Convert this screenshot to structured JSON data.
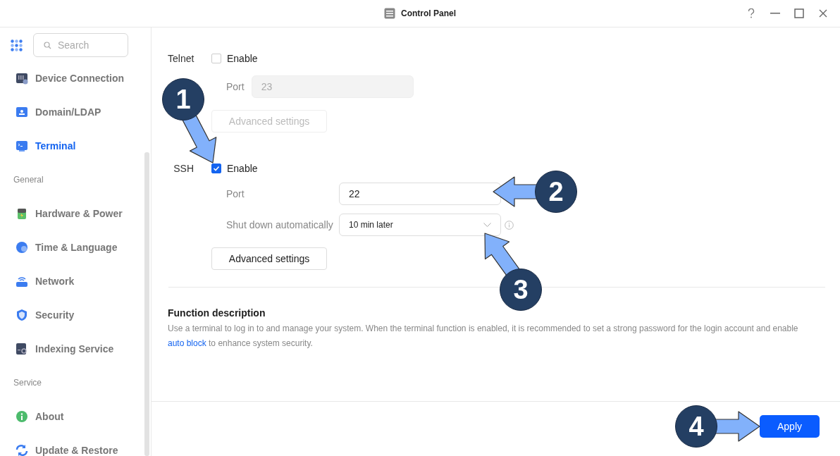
{
  "window": {
    "title": "Control Panel"
  },
  "sidebar": {
    "search": {
      "placeholder": "Search"
    },
    "sections": [
      {
        "items": [
          {
            "label": "Device Connection",
            "selected": false
          },
          {
            "label": "Domain/LDAP",
            "selected": false
          },
          {
            "label": "Terminal",
            "selected": true
          }
        ]
      },
      {
        "header": "General",
        "items": [
          {
            "label": "Hardware & Power",
            "selected": false
          },
          {
            "label": "Time & Language",
            "selected": false
          },
          {
            "label": "Network",
            "selected": false
          },
          {
            "label": "Security",
            "selected": false
          },
          {
            "label": "Indexing Service",
            "selected": false
          }
        ]
      },
      {
        "header": "Service",
        "items": [
          {
            "label": "About",
            "selected": false
          },
          {
            "label": "Update & Restore",
            "selected": false
          }
        ]
      }
    ]
  },
  "telnet": {
    "label": "Telnet",
    "enable_label": "Enable",
    "checked": false,
    "port_label": "Port",
    "port": "23",
    "advanced": "Advanced settings",
    "disabled": true
  },
  "ssh": {
    "label": "SSH",
    "enable_label": "Enable",
    "checked": true,
    "port_label": "Port",
    "port": "22",
    "shutdown_label": "Shut down automatically",
    "shutdown": "10 min later",
    "advanced": "Advanced settings",
    "disabled": false
  },
  "description": {
    "title": "Function description",
    "text": "Use a terminal to log in to and manage your system. When the terminal function is enabled, it is recommended to set a strong password for the login account and enable ",
    "link": "auto block",
    "after": " to enhance system security."
  },
  "footer": {
    "apply": "Apply"
  },
  "annotations": [
    {
      "number": "1"
    },
    {
      "number": "2"
    },
    {
      "number": "3"
    },
    {
      "number": "4"
    }
  ]
}
